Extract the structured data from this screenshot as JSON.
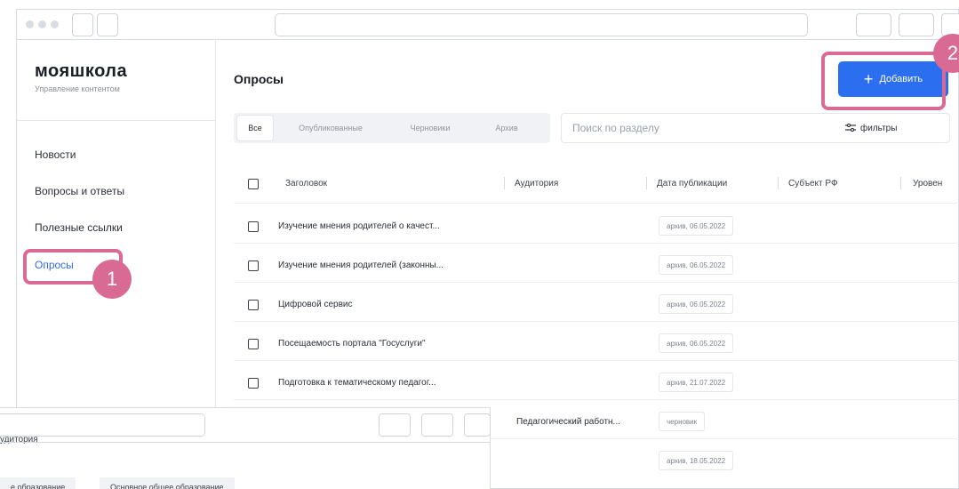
{
  "app": {
    "logo": "мояшкола",
    "logo_subtitle": "Управление контентом"
  },
  "sidebar": {
    "items": [
      {
        "label": "Новости"
      },
      {
        "label": "Вопросы и ответы"
      },
      {
        "label": "Полезные ссылки"
      },
      {
        "label": "Опросы",
        "active": true
      }
    ]
  },
  "main": {
    "title": "Опросы",
    "add_label": "Добавить",
    "tabs": [
      {
        "label": "Все",
        "active": true
      },
      {
        "label": "Опубликованные"
      },
      {
        "label": "Черновики"
      },
      {
        "label": "Архив"
      }
    ],
    "search_placeholder": "Поиск по разделу",
    "filters_label": "фильтры"
  },
  "table": {
    "headers": [
      "Заголовок",
      "Аудитория",
      "Дата публикации",
      "Субъект РФ",
      "Уровен"
    ],
    "rows": [
      {
        "title": "Изучение мнения родителей о качест...",
        "audience": "",
        "status": "архив, 06.05.2022"
      },
      {
        "title": "Изучение мнения родителей (законны...",
        "audience": "",
        "status": "архив, 06.05.2022"
      },
      {
        "title": "Цифровой сервис",
        "audience": "",
        "status": "архив, 06.05.2022"
      },
      {
        "title": "Посещаемость портала \"Госуслуги\"",
        "audience": "",
        "status": "архив, 06.05.2022"
      },
      {
        "title": "Подготовка к тематическому педагог...",
        "audience": "",
        "status": "архив, 21.07.2022"
      },
      {
        "title": "",
        "audience": "Педагогический работн...",
        "status": "черновик"
      },
      {
        "title": "",
        "audience": "",
        "status": "архив, 18.05.2022"
      }
    ]
  },
  "callouts": {
    "step1": "1",
    "step2": "2"
  },
  "overlay_window": {
    "cut_text": "удитория",
    "chips": [
      "е образование",
      "Основное общее образование"
    ]
  },
  "colors": {
    "accent": "#2b6ff0",
    "highlight": "#d96a93"
  }
}
